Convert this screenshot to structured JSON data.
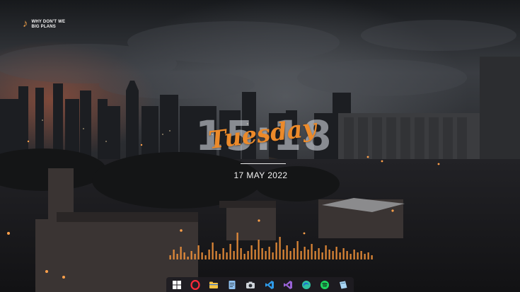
{
  "music_widget": {
    "icon": "music-note-icon",
    "track_title": "WHY DON'T WE BIG PLANS",
    "accent": "#f0a24a"
  },
  "clock": {
    "time": "15:18",
    "day": "Tuesday",
    "date": "17 MAY 2022",
    "day_color": "#ec8a2a"
  },
  "visualizer": {
    "color": "#ff9a3c",
    "levels": [
      0.15,
      0.35,
      0.2,
      0.45,
      0.25,
      0.1,
      0.3,
      0.2,
      0.5,
      0.25,
      0.15,
      0.35,
      0.6,
      0.3,
      0.2,
      0.4,
      0.25,
      0.55,
      0.3,
      0.95,
      0.4,
      0.2,
      0.3,
      0.5,
      0.35,
      0.7,
      0.4,
      0.3,
      0.45,
      0.25,
      0.6,
      0.8,
      0.35,
      0.5,
      0.3,
      0.4,
      0.65,
      0.3,
      0.45,
      0.35,
      0.55,
      0.3,
      0.4,
      0.25,
      0.5,
      0.35,
      0.3,
      0.45,
      0.25,
      0.4,
      0.3,
      0.2,
      0.35,
      0.25,
      0.3,
      0.2,
      0.25,
      0.15
    ]
  },
  "taskbar": {
    "items": [
      {
        "name": "windows-start-icon",
        "color": "#ffffff"
      },
      {
        "name": "opera-icon",
        "color": "#ff2a3a"
      },
      {
        "name": "file-explorer-icon",
        "color": "#f6c343"
      },
      {
        "name": "notepad-icon",
        "color": "#8fc0f0"
      },
      {
        "name": "camera-icon",
        "color": "#d0d4da"
      },
      {
        "name": "vscode-icon",
        "color": "#2f9bea"
      },
      {
        "name": "visual-studio-icon",
        "color": "#9a63d8"
      },
      {
        "name": "edge-icon",
        "color": "#2fc0a0"
      },
      {
        "name": "spotify-icon",
        "color": "#1ed760"
      },
      {
        "name": "notes-icon",
        "color": "#a8d4f2"
      }
    ]
  }
}
